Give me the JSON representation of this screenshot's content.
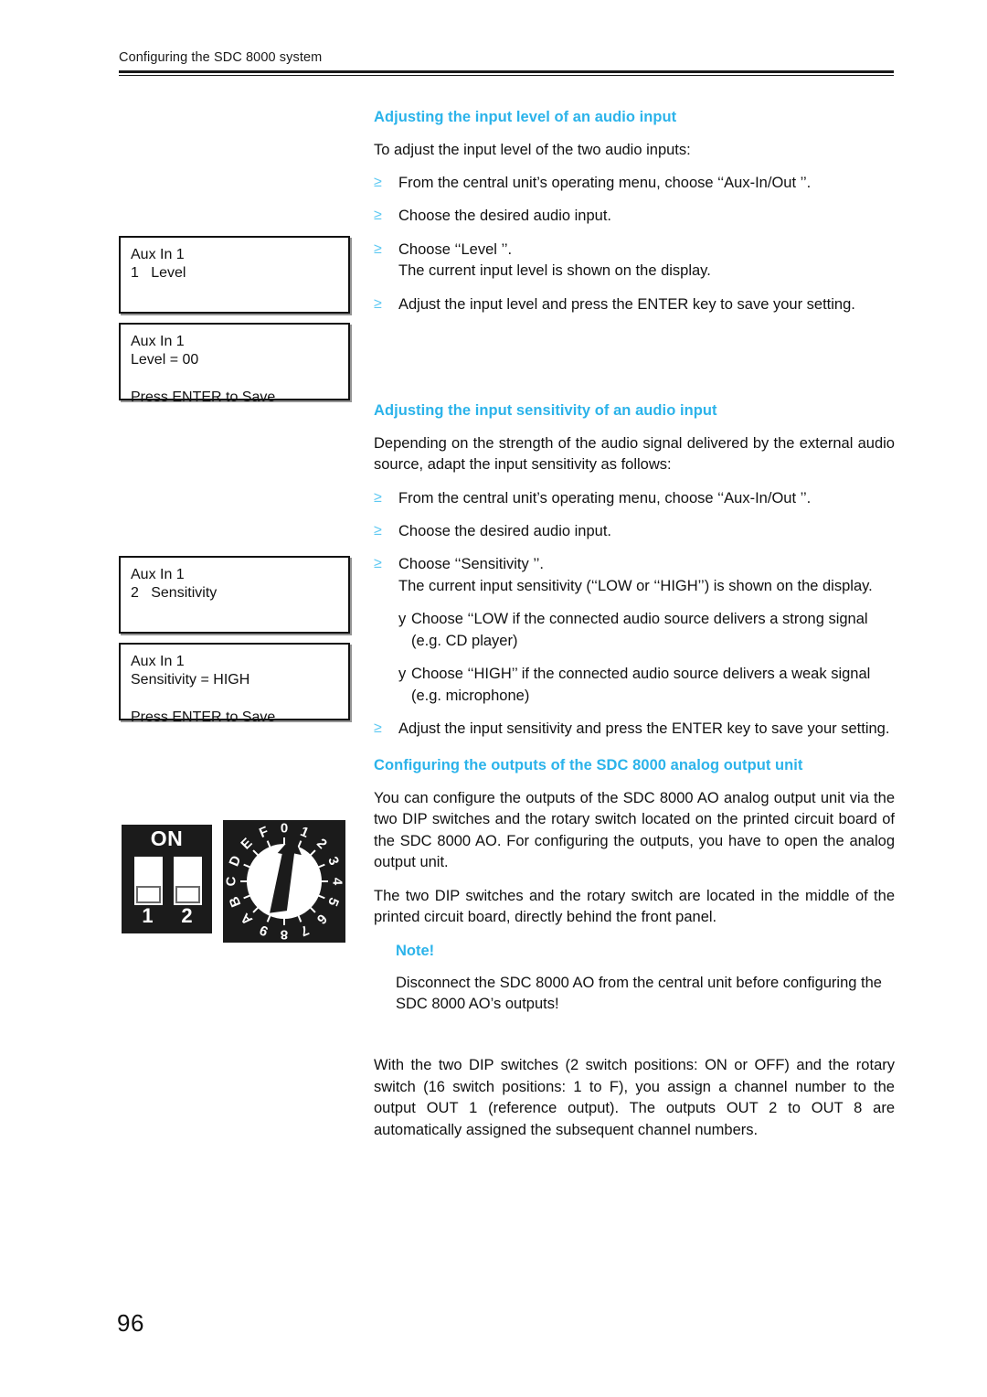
{
  "header": {
    "running_head": "Configuring the SDC 8000 system"
  },
  "page_number": "96",
  "colors": {
    "heading_blue": "#2bb3ea",
    "bullet_blue": "#5cc8f2",
    "text_black": "#111111",
    "graphic_black": "#1b1b1b"
  },
  "icons": {
    "arrow_bullet": "≥",
    "y_bullet": "y"
  },
  "sections": [
    {
      "heading": "Adjusting the input level of an audio input",
      "intro": "To adjust the input level of the two audio inputs:",
      "steps": [
        "From the central unit’s operating menu, choose ‘‘Aux-In/Out    ’’.",
        "Choose the desired audio input.",
        "Choose ‘‘Level   ’’.",
        "Adjust the input level and press the ENTER key to save your setting."
      ],
      "step3_second_line": "The current input level is shown on the display."
    },
    {
      "heading": "Adjusting the input sensitivity of an audio input",
      "intro": "Depending on the strength of the audio signal delivered by the external audio source, adapt the input sensitivity as follows:",
      "steps": [
        "From the central unit’s operating menu, choose ‘‘Aux-In/Out    ’’.",
        "Choose the desired audio input.",
        "Choose ‘‘Sensitivity       ’’.",
        "Adjust the input sensitivity and press the ENTER key to save your setting."
      ],
      "step3_second_line": "The current input sensitivity (‘‘LOW or ‘‘HIGH’’) is shown on the display.",
      "sub_bullets": [
        "Choose ‘‘LOW if the connected audio source delivers a strong signal (e.g. CD player)",
        "Choose ‘‘HIGH’’ if the connected audio source delivers a weak signal (e.g. microphone)"
      ]
    },
    {
      "heading": "Configuring the outputs of the SDC 8000 analog output unit",
      "paragraphs": [
        "You can configure the outputs of the SDC 8000 AO analog output unit via the two DIP switches and the rotary switch located on the printed circuit board of the SDC 8000 AO. For configuring the outputs, you have to open the analog output unit.",
        "The two DIP switches and the rotary switch are located in the middle of the printed circuit board, directly behind the front panel."
      ],
      "note": {
        "title": "Note!",
        "body": "Disconnect the SDC 8000 AO from the central unit before configuring the SDC 8000 AO’s outputs!"
      },
      "closing_paragraph": "With the two DIP switches (2 switch positions: ON or OFF) and the rotary switch (16 switch positions: 1 to F), you assign a channel number to the output OUT 1 (reference output). The outputs OUT 2 to OUT 8 are automatically assigned the subsequent channel numbers."
    }
  ],
  "lcd_displays": [
    {
      "id": "level-menu",
      "lines": [
        "Aux In 1",
        "1   Level",
        "",
        ""
      ]
    },
    {
      "id": "level-edit",
      "lines": [
        "Aux In 1",
        "Level = 00",
        "",
        "Press ENTER to Save"
      ]
    },
    {
      "id": "sensitivity-menu",
      "lines": [
        "Aux In 1",
        "2   Sensitivity",
        "",
        ""
      ]
    },
    {
      "id": "sensitivity-edit",
      "lines": [
        "Aux In 1",
        "Sensitivity = HIGH",
        "",
        "Press ENTER to Save"
      ]
    }
  ],
  "dip_switch": {
    "on_label": "ON",
    "switch_1_number": "1",
    "switch_2_number": "2",
    "switch_1_position": "OFF",
    "switch_2_position": "OFF"
  },
  "rotary_switch": {
    "positions": [
      "0",
      "1",
      "2",
      "3",
      "4",
      "5",
      "6",
      "7",
      "8",
      "9",
      "A",
      "B",
      "C",
      "D",
      "E",
      "F"
    ],
    "pointer_position": "1"
  }
}
